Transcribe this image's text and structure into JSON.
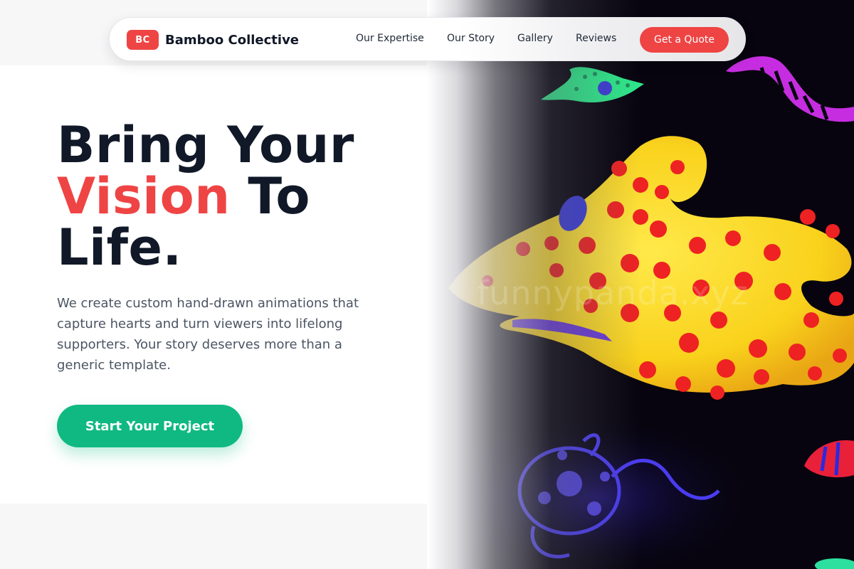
{
  "brand": {
    "badge": "BC",
    "name": "Bamboo Collective",
    "accent_color": "#ef4444"
  },
  "nav": {
    "links": [
      "Our Expertise",
      "Our Story",
      "Gallery",
      "Reviews"
    ],
    "cta_label": "Get a Quote"
  },
  "hero": {
    "headline_part1": "Bring Your",
    "headline_accent": "Vision",
    "headline_part2": "To",
    "headline_part3": "Life.",
    "subtitle": "We create custom hand-drawn animations that capture hearts and turn viewers into lifelong supporters. Your story deserves more than a generic template.",
    "cta_label": "Start Your Project",
    "cta_color": "#10b981"
  },
  "image": {
    "description_icon": "neon-fish-illustration",
    "watermark": "funnypanda.xyz"
  }
}
